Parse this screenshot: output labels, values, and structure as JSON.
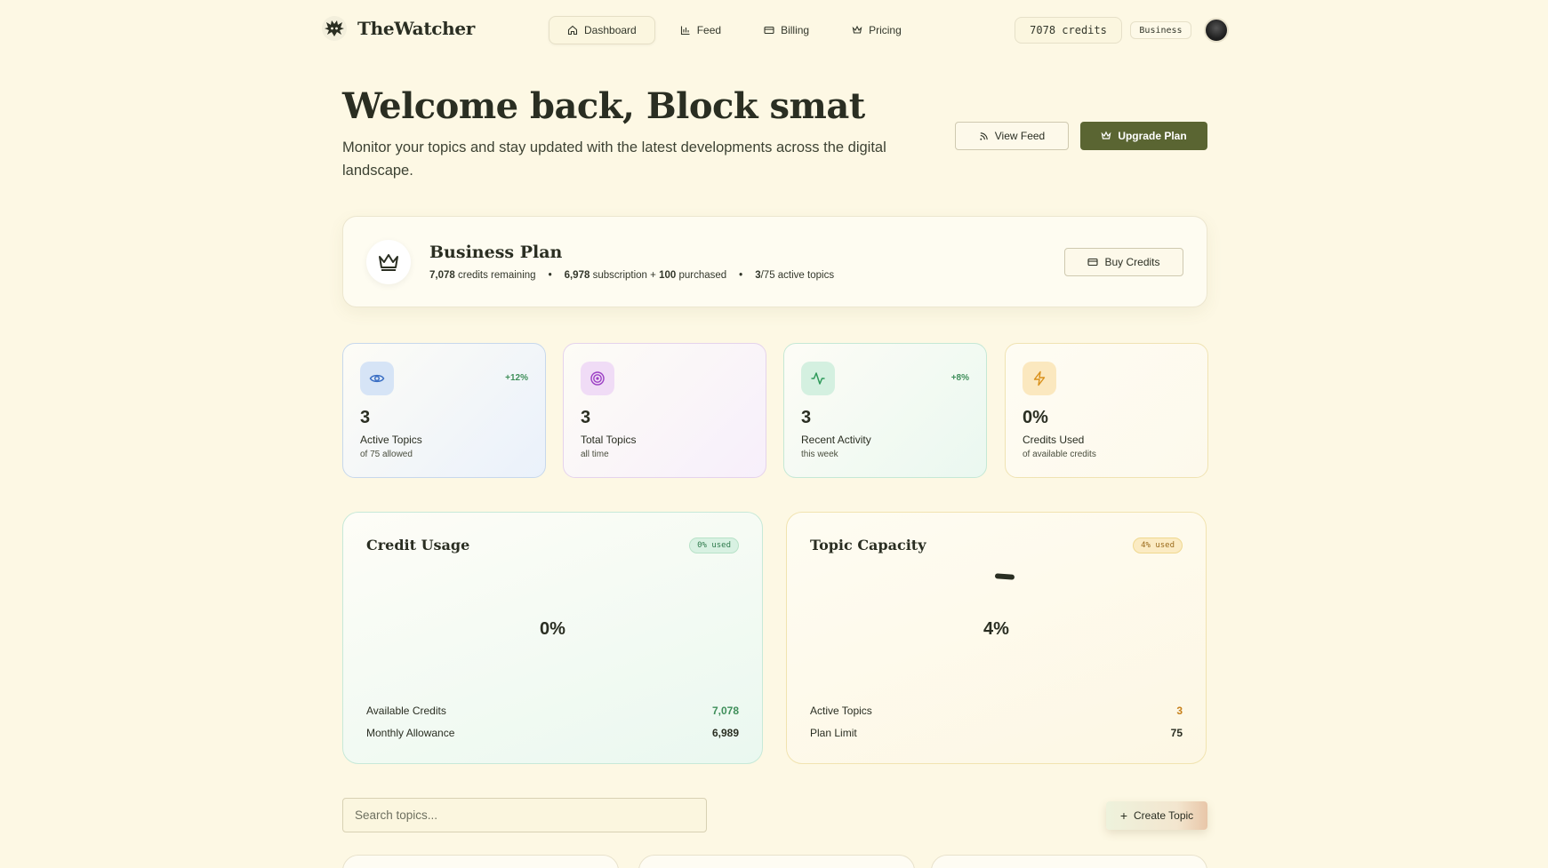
{
  "brand": {
    "name": "TheWatcher",
    "logo_icon": "watcher-logo-icon"
  },
  "nav": {
    "links": [
      {
        "label": "Dashboard",
        "icon": "home-icon",
        "active": true
      },
      {
        "label": "Feed",
        "icon": "bar-chart-icon",
        "active": false
      },
      {
        "label": "Billing",
        "icon": "card-icon",
        "active": false
      },
      {
        "label": "Pricing",
        "icon": "crown-icon",
        "active": false
      }
    ],
    "credits": "7078 credits",
    "plan_badge": "Business"
  },
  "hero": {
    "title": "Welcome back, Block smat",
    "subtitle": "Monitor your topics and stay updated with the latest developments across the digital landscape.",
    "view_feed": "View Feed",
    "upgrade": "Upgrade Plan"
  },
  "plan": {
    "title": "Business Plan",
    "credits_remaining_value": "7,078",
    "credits_remaining_label": "credits remaining",
    "subscription_value": "6,978",
    "subscription_label": "subscription +",
    "purchased_value": "100",
    "purchased_label": "purchased",
    "topics_value": "3",
    "topics_label": "/75 active topics",
    "buy_credits": "Buy Credits"
  },
  "stats": [
    {
      "value": "3",
      "label": "Active Topics",
      "sub": "of 75 allowed",
      "delta": "+12%",
      "icon": "eye-icon",
      "accent": "#3b6fc4"
    },
    {
      "value": "3",
      "label": "Total Topics",
      "sub": "all time",
      "delta": "",
      "icon": "target-icon",
      "accent": "#9b3fc4"
    },
    {
      "value": "3",
      "label": "Recent Activity",
      "sub": "this week",
      "delta": "+8%",
      "icon": "activity-icon",
      "accent": "#2f9a5a"
    },
    {
      "value": "0%",
      "label": "Credits Used",
      "sub": "of available credits",
      "delta": "",
      "icon": "lightning-icon",
      "accent": "#d9901a"
    }
  ],
  "credit_usage": {
    "title": "Credit Usage",
    "badge": "0% used",
    "center": "0%",
    "rows": [
      {
        "label": "Available Credits",
        "value": "7,078"
      },
      {
        "label": "Monthly Allowance",
        "value": "6,989"
      }
    ]
  },
  "topic_capacity": {
    "title": "Topic Capacity",
    "badge": "4% used",
    "center": "4%",
    "rows": [
      {
        "label": "Active Topics",
        "value": "3"
      },
      {
        "label": "Plan Limit",
        "value": "75"
      }
    ]
  },
  "search": {
    "placeholder": "Search topics..."
  },
  "create_topic": "Create Topic"
}
